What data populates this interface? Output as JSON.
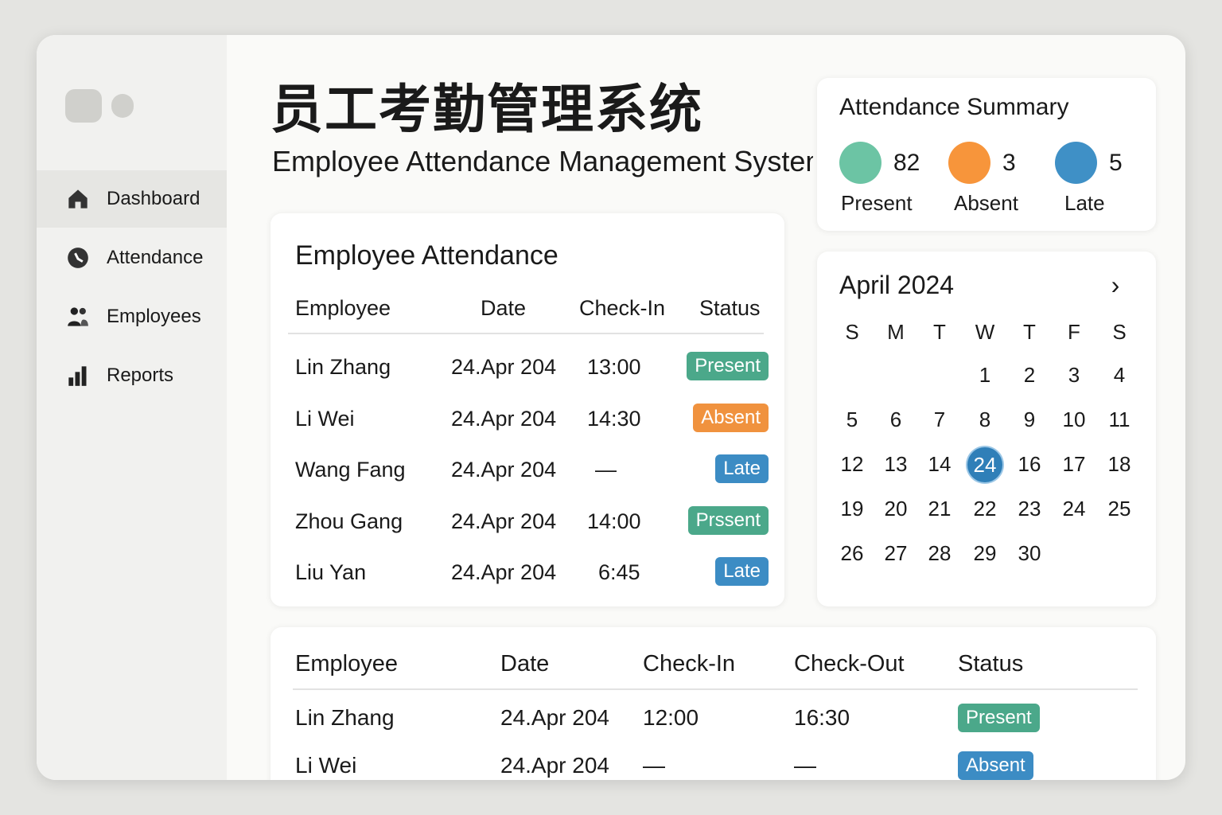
{
  "title_cn": "员工考勤管理系统",
  "title_en": "Employee Attendance Management System",
  "sidebar": {
    "items": [
      {
        "label": "Dashboard",
        "icon": "home-icon"
      },
      {
        "label": "Attendance",
        "icon": "clock-icon"
      },
      {
        "label": "Employees",
        "icon": "users-icon"
      },
      {
        "label": "Reports",
        "icon": "bar-chart-icon"
      }
    ]
  },
  "summary": {
    "title": "Attendance Summary",
    "items": [
      {
        "count": "82",
        "label": "Present",
        "color": "#6cc4a4"
      },
      {
        "count": "3",
        "label": "Absent",
        "color": "#f7953b"
      },
      {
        "count": "5",
        "label": "Late",
        "color": "#3f90c6"
      }
    ]
  },
  "attendance": {
    "title": "Employee Attendance",
    "headers": [
      "Employee",
      "Date",
      "Check-In",
      "Status"
    ],
    "rows": [
      [
        "Lin Zhang",
        "24.Apr 204",
        "13:00",
        "Present"
      ],
      [
        "Li Wei",
        "24.Apr 204",
        "14:30",
        "Absent"
      ],
      [
        "Wang Fang",
        "24.Apr 204",
        "—",
        "Late"
      ],
      [
        "Zhou Gang",
        "24.Apr 204",
        "14:00",
        "Prssent"
      ],
      [
        "Liu Yan",
        "24.Apr 204",
        "6:45",
        "Late"
      ]
    ]
  },
  "calendar": {
    "month": "April 2024",
    "weekdays": [
      "S",
      "M",
      "T",
      "W",
      "T",
      "F",
      "S"
    ],
    "weeks": [
      [
        "",
        "",
        "",
        "1",
        "2",
        "3",
        "4"
      ],
      [
        "5",
        "6",
        "7",
        "8",
        "9",
        "10",
        "11"
      ],
      [
        "12",
        "13",
        "14",
        "24",
        "16",
        "17",
        "18"
      ],
      [
        "19",
        "20",
        "21",
        "22",
        "23",
        "24",
        "25"
      ],
      [
        "26",
        "27",
        "28",
        "29",
        "30",
        "",
        ""
      ]
    ],
    "selected": "24"
  },
  "log": {
    "headers": [
      "Employee",
      "Date",
      "Check-In",
      "Check-Out",
      "Status"
    ],
    "rows": [
      [
        "Lin Zhang",
        "24.Apr 204",
        "12:00",
        "16:30",
        "Present"
      ],
      [
        "Li Wei",
        "24.Apr 204",
        "—",
        "—",
        "Absent"
      ]
    ]
  },
  "colors": {
    "Present": "#4ba88a",
    "Prssent": "#4ba88a",
    "Absent": "#f0923e",
    "Late": "#3c8cc4",
    "AbsentLog": "#3c8cc4"
  }
}
